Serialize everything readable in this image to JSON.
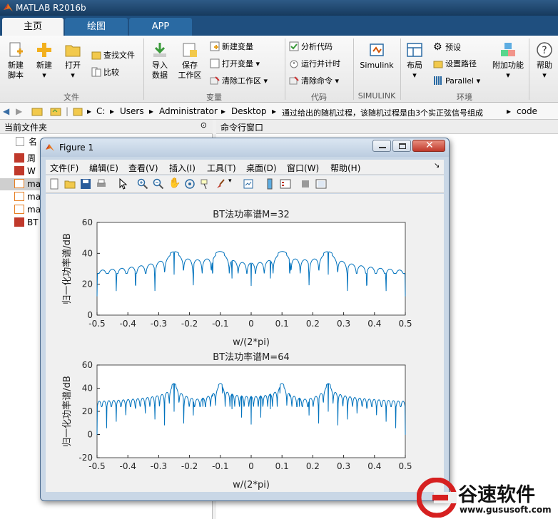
{
  "app": {
    "title": "MATLAB R2016b"
  },
  "tabs": [
    {
      "label": "主页"
    },
    {
      "label": "绘图"
    },
    {
      "label": "APP"
    }
  ],
  "ribbon": {
    "new_script": "新建\n脚本",
    "new": "新建",
    "open": "打开",
    "find_files": "查找文件",
    "compare": "比较",
    "import_data": "导入\n数据",
    "save_workspace": "保存\n工作区",
    "new_variable": "新建变量",
    "open_variable": "打开变量",
    "clear_workspace": "清除工作区",
    "analyze_code": "分析代码",
    "run_and_time": "运行并计时",
    "clear_commands": "清除命令",
    "simulink": "Simulink",
    "layout": "布局",
    "preferences": "预设",
    "set_path": "设置路径",
    "parallel": "Parallel",
    "addons": "附加功能",
    "help": "帮助",
    "groups": {
      "file": "文件",
      "variable": "变量",
      "code": "代码",
      "simulink": "SIMULINK",
      "environment": "环境"
    }
  },
  "address": {
    "segments": [
      "C:",
      "Users",
      "Administrator",
      "Desktop",
      "通过给出的随机过程，该随机过程是由3个实正弦信号组成",
      "code"
    ]
  },
  "current_folder": {
    "title": "当前文件夹",
    "column": "名",
    "files": [
      {
        "name": "周",
        "type": "png"
      },
      {
        "name": "W",
        "type": "png"
      },
      {
        "name": "ma",
        "type": "m"
      },
      {
        "name": "ma",
        "type": "m"
      },
      {
        "name": "ma",
        "type": "m"
      },
      {
        "name": "BT",
        "type": "png"
      }
    ]
  },
  "command_window": {
    "title": "命令行窗口"
  },
  "figure": {
    "title": "Figure 1",
    "menu": [
      "文件(F)",
      "编辑(E)",
      "查看(V)",
      "插入(I)",
      "工具(T)",
      "桌面(D)",
      "窗口(W)",
      "帮助(H)"
    ]
  },
  "chart_data": [
    {
      "type": "line",
      "title": "BT法功率谱M=32",
      "xlabel": "w/(2*pi)",
      "ylabel": "归一化功率谱/dB",
      "xlim": [
        -0.5,
        0.5
      ],
      "ylim": [
        0,
        60
      ],
      "xticks": [
        "-0.5",
        "-0.4",
        "-0.3",
        "-0.2",
        "-0.1",
        "0",
        "0.1",
        "0.2",
        "0.3",
        "0.4",
        "0.5"
      ],
      "yticks": [
        "0",
        "20",
        "40",
        "60"
      ],
      "color": "#0072bd",
      "M": 32,
      "series": [
        {
          "peaks_at": [
            -0.25,
            -0.1,
            0.1,
            0.25
          ],
          "peak_level_db": 41,
          "floor_db": 27
        }
      ]
    },
    {
      "type": "line",
      "title": "BT法功率谱M=64",
      "xlabel": "w/(2*pi)",
      "ylabel": "归一化功率谱/dB",
      "xlim": [
        -0.5,
        0.5
      ],
      "ylim": [
        -20,
        60
      ],
      "xticks": [
        "-0.5",
        "-0.4",
        "-0.3",
        "-0.2",
        "-0.1",
        "0",
        "0.1",
        "0.2",
        "0.3",
        "0.4",
        "0.5"
      ],
      "yticks": [
        "-20",
        "0",
        "20",
        "40",
        "60"
      ],
      "color": "#0072bd",
      "M": 64,
      "series": [
        {
          "peaks_at": [
            -0.25,
            -0.1,
            0.1,
            0.25
          ],
          "peak_level_db": 44,
          "floor_db": 24
        }
      ]
    }
  ],
  "watermark": {
    "brand": "谷速软件",
    "url": "www.gususoft.com",
    "color": "#d62020"
  }
}
